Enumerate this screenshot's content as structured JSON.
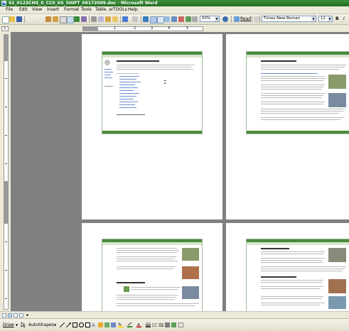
{
  "window": {
    "title": "52_0123CHG_0_CC0_US_SHIFT_06172009.doc - Microsoft Word",
    "app_icon": "W"
  },
  "menu": {
    "items": [
      "File",
      "Edit",
      "View",
      "Insert",
      "Format",
      "Tools",
      "Table",
      "arTOOLs",
      "Help"
    ]
  },
  "toolbar": {
    "zoom": "50%",
    "read_label": "Read",
    "font_name": "Times New Roman",
    "font_size": "12",
    "bold": "B",
    "italic": "I"
  },
  "ruler": {
    "corner": "L",
    "numbers": [
      "1",
      "2",
      "3",
      "4",
      "5"
    ]
  },
  "drawing_toolbar": {
    "draw_label": "Draw",
    "autoshapes_label": "AutoShapes"
  },
  "colors": {
    "title_bar": "#1f6e1f",
    "chrome": "#ece9d8",
    "workspace": "#808080",
    "page": "#ffffff",
    "thumb_accent": "#4a8a3a"
  }
}
